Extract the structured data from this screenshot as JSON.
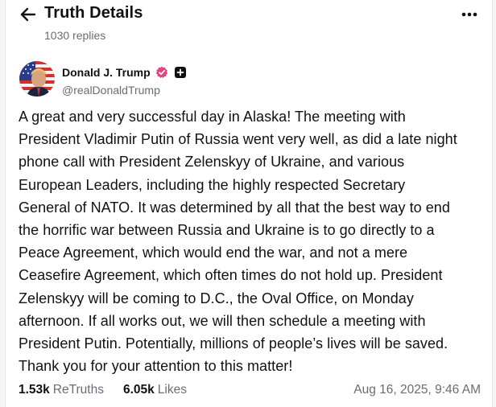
{
  "header": {
    "title": "Truth Details",
    "replies": "1030 replies"
  },
  "author": {
    "name": "Donald J. Trump",
    "handle": "@realDonaldTrump"
  },
  "post": {
    "text": "A great and very successful day in Alaska! The meeting with\nPresident Vladimir Putin of Russia went very well, as did a late night\nphone call with President Zelenskyy of Ukraine, and various\nEuropean Leaders, including the highly respected Secretary\nGeneral of NATO. It was determined by all that the best way to end\nthe horrific war between Russia and Ukraine is to go directly to a\nPeace Agreement, which would end the war, and not a mere\nCeasefire Agreement, which often times do not hold up. President\nZelenskyy will be coming to D.C., the Oval Office, on Monday\nafternoon. If all works out, we will then schedule a meeting with\nPresident Putin. Potentially, millions of people’s lives will be saved.\nThank you for your attention to this matter!"
  },
  "stats": {
    "retruths_count": "1.53k",
    "retruths_label": "ReTruths",
    "likes_count": "6.05k",
    "likes_label": "Likes",
    "date": "Aug 16, 2025, 9:46 AM"
  },
  "icons": {
    "back": "arrow-left-icon",
    "more": "more-horizontal-icon",
    "verified": "verified-badge-icon",
    "plus": "plus-square-icon"
  },
  "colors": {
    "verified": "#e0457b",
    "text": "#111111",
    "muted": "#6b6b76"
  }
}
